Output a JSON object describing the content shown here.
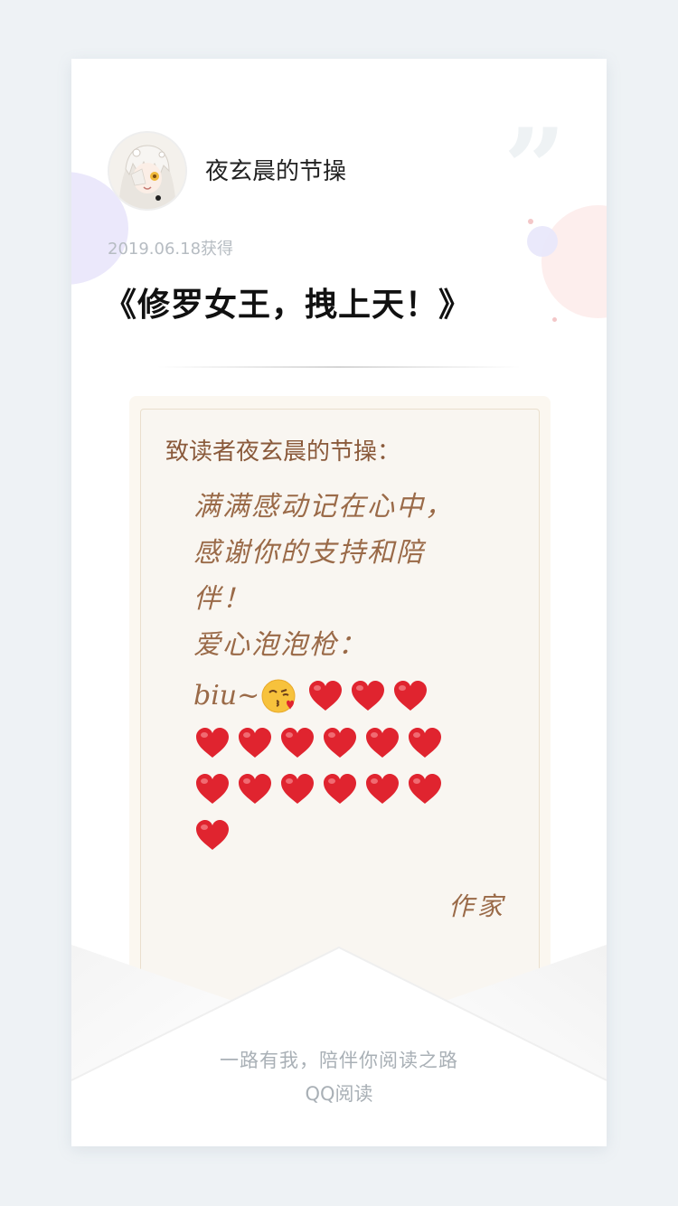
{
  "profile": {
    "username": "夜玄晨的节操",
    "date_obtained": "2019.06.18获得"
  },
  "book": {
    "title": "《修罗女王，拽上天！》"
  },
  "letter": {
    "greeting": "致读者夜玄晨的节操：",
    "message": "满满感动记在心中，\n感谢你的支持和陪\n伴！\n爱心泡泡枪：",
    "biu_text": "biu~",
    "signature": "作家",
    "heart_count": 16
  },
  "footer": {
    "slogan": "一路有我，陪伴你阅读之路",
    "brand": "QQ阅读"
  },
  "colors": {
    "accent_brown": "#9a6a48",
    "heart_red": "#e0242f",
    "card_bg": "#ffffff",
    "page_bg": "#eef2f5"
  },
  "icons": [
    "avatar-image",
    "quote-mark-icon",
    "kiss-emoji-icon",
    "heart-icon"
  ]
}
